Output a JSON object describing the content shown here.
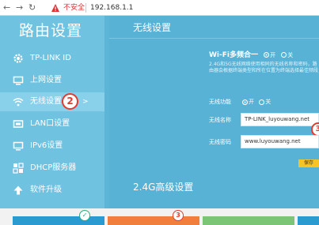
{
  "browser": {
    "security_label": "不安全",
    "url": "192.168.1.1"
  },
  "sidebar": {
    "title": "路由设置",
    "items": [
      {
        "label": "TP-LINK ID",
        "icon": "gear-icon"
      },
      {
        "label": "上网设置",
        "icon": "monitor-icon"
      },
      {
        "label": "无线设置",
        "icon": "wifi-icon",
        "active": true,
        "annotation": "2"
      },
      {
        "label": "LAN口设置",
        "icon": "lan-icon"
      },
      {
        "label": "IPv6设置",
        "icon": "monitor-icon"
      },
      {
        "label": "DHCP服务器",
        "icon": "dhcp-icon"
      },
      {
        "label": "软件升级",
        "icon": "upload-icon"
      }
    ],
    "chevron": ">"
  },
  "main": {
    "panel_title": "无线设置",
    "multi_band": {
      "title": "Wi-Fi多频合一",
      "on_label": "开",
      "off_label": "关",
      "description": "2.4G和5G无线网络使用相同的无线名称和密码，路由器会根据终端类型和所在位置为终端选择最佳频段"
    },
    "wireless_switch": {
      "label": "无线功能",
      "on_label": "开",
      "off_label": "关"
    },
    "ssid": {
      "label": "无线名称",
      "value": "TP-LINK_luyouwang.net",
      "annotation": "3"
    },
    "password": {
      "label": "无线密码",
      "value": "www.luyouwang.net"
    },
    "save_label": "保存",
    "advanced_title": "2.4G高级设置"
  },
  "bottom": {
    "badges": [
      "✓",
      "3"
    ]
  },
  "colors": {
    "sidebar_bg": "#6fc2e0",
    "main_bg": "#58b2d6",
    "annotation_red": "#e43b2f",
    "save_yellow": "#f7c325"
  }
}
